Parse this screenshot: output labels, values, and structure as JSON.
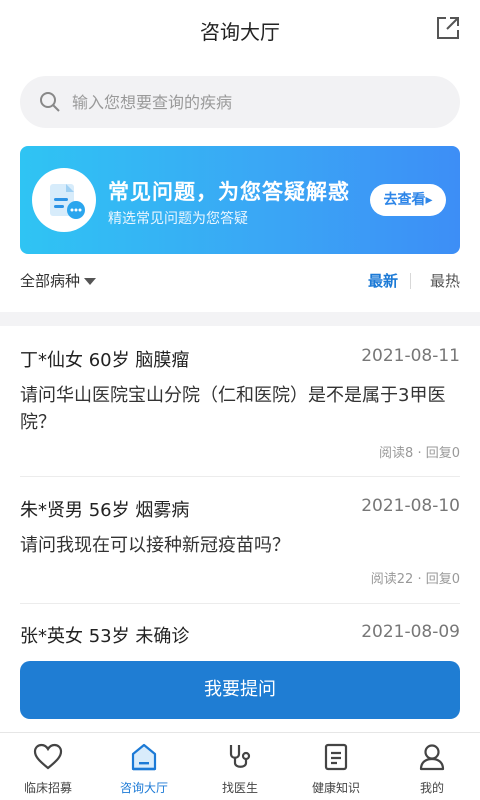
{
  "header": {
    "title": "咨询大厅",
    "share_icon": "share-icon"
  },
  "search": {
    "placeholder": "输入您想要查询的疾病",
    "icon": "search-icon"
  },
  "banner": {
    "title": "常见问题，为您答疑解惑",
    "subtitle": "精选常见问题为您答疑",
    "button": "去查看▸",
    "icon": "document-chat-icon",
    "gradient": [
      "#2fc4f3",
      "#3d8ef6"
    ]
  },
  "filter": {
    "category": "全部病种",
    "newest": "最新",
    "hottest": "最热"
  },
  "questions": [
    {
      "who": "丁*仙女 60岁 脑膜瘤",
      "date": "2021-08-11",
      "question": "请问华山医院宝山分院（仁和医院）是不是属于3甲医院？",
      "meta": "阅读8 · 回复0"
    },
    {
      "who": "朱*贤男 56岁 烟雾病",
      "date": "2021-08-10",
      "question": "请问我现在可以接种新冠疫苗吗？",
      "meta": "阅读22 · 回复0"
    },
    {
      "who": "张*英女 53岁 未确诊",
      "date": "2021-08-09",
      "question": "",
      "meta": ""
    }
  ],
  "ask_button": "我要提问",
  "tabs": [
    {
      "label": "临床招募",
      "icon": "heart-icon",
      "active": false
    },
    {
      "label": "咨询大厅",
      "icon": "consult-hall-icon",
      "active": true
    },
    {
      "label": "找医生",
      "icon": "stethoscope-icon",
      "active": false
    },
    {
      "label": "健康知识",
      "icon": "document-icon",
      "active": false
    },
    {
      "label": "我的",
      "icon": "user-icon",
      "active": false
    }
  ],
  "colors": {
    "accent": "#1c7ad6",
    "button": "#1f7dd3"
  }
}
